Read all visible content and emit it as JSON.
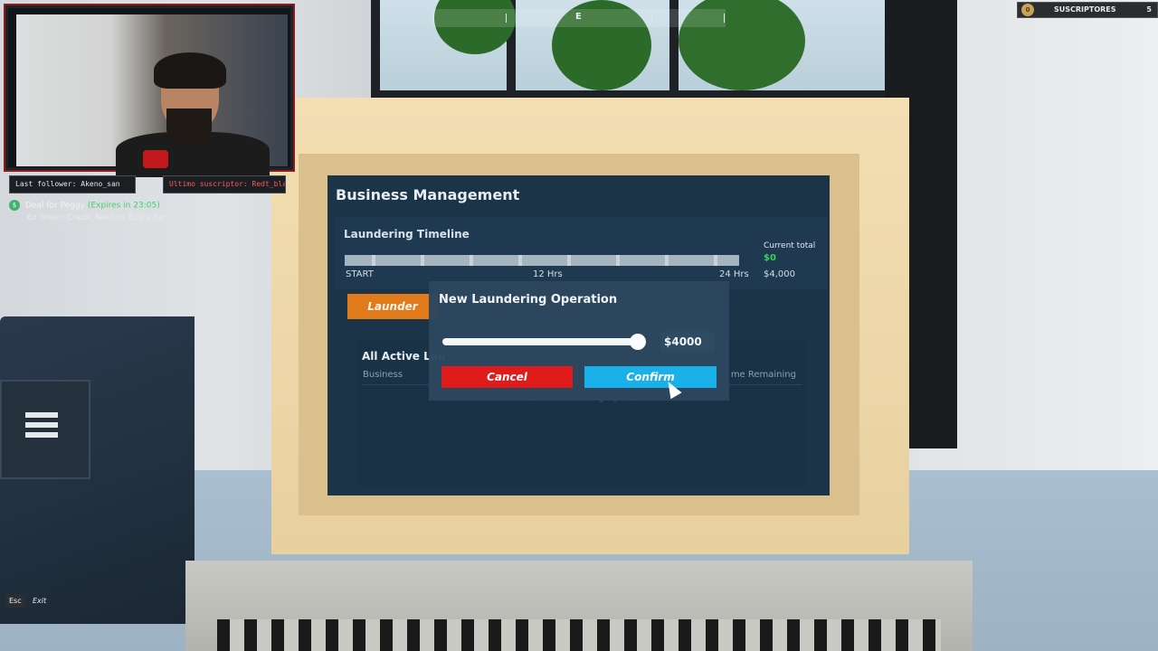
{
  "hud": {
    "compass_heading": "E",
    "subscribers": {
      "coin": "0",
      "label": "SUSCRIPTORES",
      "count": "5"
    },
    "last_follower": "Last follower: Akeno_san",
    "last_subscriber": "Ultimo suscriptor: Redt_bla",
    "quest": {
      "icon": "$",
      "title": "Deal for Peggy",
      "expires": "(Expires in 23:05)",
      "detail": "6x Green Crack, Next to Bud's Bar"
    },
    "exit_key": "Esc",
    "exit_label": "Exit"
  },
  "business_management": {
    "title": "Business Management",
    "timeline": {
      "label": "Laundering Timeline",
      "start": "START",
      "mid": "12 Hrs",
      "end": "24 Hrs",
      "current_total_label": "Current total",
      "current_total_value": "$0",
      "max_total": "$4,000"
    },
    "launder_button": "Launder",
    "active": {
      "title": "All Active Lau",
      "col_business": "Business",
      "col_time": "me Remaining",
      "empty": "No Active Laundering Operations"
    }
  },
  "modal": {
    "title": "New Laundering Operation",
    "slider_fraction": 1.0,
    "amount": "$4000",
    "cancel": "Cancel",
    "confirm": "Confirm"
  },
  "colors": {
    "launder": "#e07a1b",
    "cancel": "#e01b1b",
    "confirm": "#1ab0ea",
    "current_total": "#39d353"
  }
}
